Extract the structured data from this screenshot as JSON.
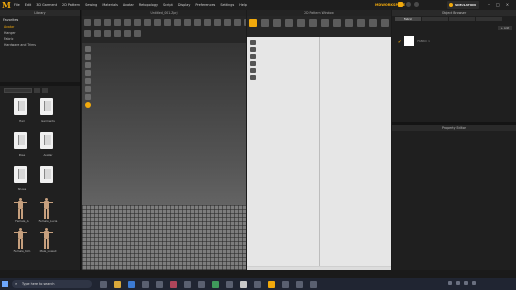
{
  "app": {
    "menu": [
      "File",
      "Edit",
      "3D Garment",
      "2D Pattern",
      "Sewing",
      "Materials",
      "Avatar",
      "Retopology",
      "Script",
      "Display",
      "Preferences",
      "Settings",
      "Help"
    ],
    "workspace": "MDWORKSPACE",
    "simulation_label": "SIMULATION"
  },
  "library": {
    "title": "Library",
    "favorites_header": "Favorites",
    "favorites": [
      "Avatar",
      "Hanger",
      "Fabric",
      "Hardware and Trims"
    ],
    "selected_favorite": "Avatar",
    "tiles": [
      {
        "label": "Hair",
        "kind": "folder"
      },
      {
        "label": "Garments",
        "kind": "folder"
      },
      {
        "label": "Pose",
        "kind": "folder"
      },
      {
        "label": "Avatar",
        "kind": "folder"
      },
      {
        "label": "Shoes",
        "kind": "folder"
      },
      {
        "label": "",
        "kind": "folder"
      },
      {
        "label": "Female_A",
        "kind": "avatar"
      },
      {
        "label": "Female_Lucia",
        "kind": "avatar"
      },
      {
        "label": "Female_Kim",
        "kind": "avatar"
      },
      {
        "label": "Male_Lowell",
        "kind": "avatar"
      }
    ]
  },
  "view3d": {
    "title": "Untitled_001.Zprj"
  },
  "view2d": {
    "title": "2D Pattern Window"
  },
  "object_browser": {
    "title": "Object Browser",
    "tabs": [
      "Fabric",
      "",
      "",
      ""
    ],
    "add_label": "+ Add",
    "fabric_name": "FABRIC 1"
  },
  "property_editor": {
    "title": "Property Editor"
  },
  "taskbar": {
    "search_placeholder": "Type here to search",
    "time": "",
    "date": ""
  },
  "colors": {
    "accent": "#f1a90c",
    "viewport_2d": "#e6e6e6"
  }
}
